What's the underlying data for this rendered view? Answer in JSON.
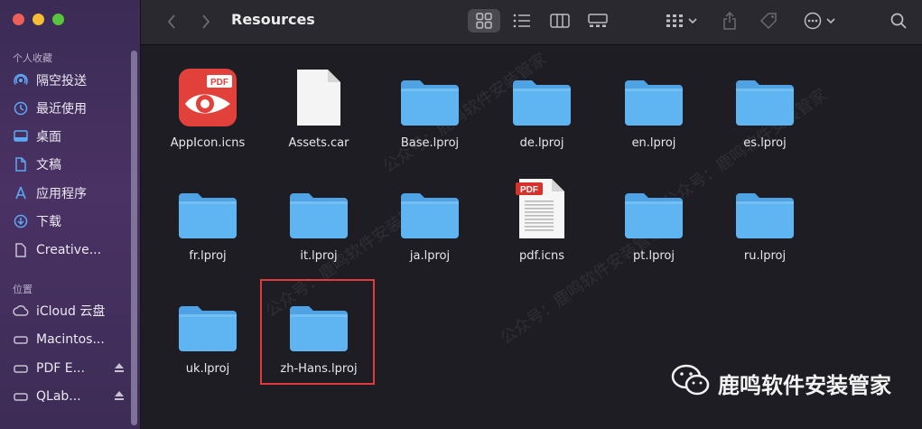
{
  "window": {
    "title": "Resources"
  },
  "sidebar": {
    "favorites_header": "个人收藏",
    "favorites": [
      {
        "label": "隔空投送",
        "icon": "airdrop-icon"
      },
      {
        "label": "最近使用",
        "icon": "clock-icon"
      },
      {
        "label": "桌面",
        "icon": "desktop-icon"
      },
      {
        "label": "文稿",
        "icon": "document-icon"
      },
      {
        "label": "应用程序",
        "icon": "applications-icon"
      },
      {
        "label": "下载",
        "icon": "download-icon"
      },
      {
        "label": "Creative...",
        "icon": "file-icon"
      }
    ],
    "locations_header": "位置",
    "locations": [
      {
        "label": "iCloud 云盘",
        "icon": "cloud-icon"
      },
      {
        "label": "Macintos...",
        "icon": "disk-icon"
      },
      {
        "label": "PDF E...",
        "icon": "disk-icon",
        "eject": true
      },
      {
        "label": "QLab...",
        "icon": "disk-icon",
        "eject": true
      }
    ]
  },
  "files": [
    {
      "name": "AppIcon.icns",
      "kind": "pdfexpert"
    },
    {
      "name": "Assets.car",
      "kind": "blank"
    },
    {
      "name": "Base.lproj",
      "kind": "folder"
    },
    {
      "name": "de.lproj",
      "kind": "folder"
    },
    {
      "name": "en.lproj",
      "kind": "folder"
    },
    {
      "name": "es.lproj",
      "kind": "folder"
    },
    {
      "name": "fr.lproj",
      "kind": "folder"
    },
    {
      "name": "it.lproj",
      "kind": "folder"
    },
    {
      "name": "ja.lproj",
      "kind": "folder"
    },
    {
      "name": "pdf.icns",
      "kind": "pdfdoc"
    },
    {
      "name": "pt.lproj",
      "kind": "folder"
    },
    {
      "name": "ru.lproj",
      "kind": "folder"
    },
    {
      "name": "uk.lproj",
      "kind": "folder"
    },
    {
      "name": "zh-Hans.lproj",
      "kind": "folder"
    }
  ],
  "icon_badges": {
    "pdf": "PDF"
  },
  "watermark": {
    "text": "鹿鸣软件安装管家",
    "diag": "公众号：鹿鸣软件安装管家"
  },
  "colors": {
    "folder": "#5fb4f2",
    "highlight": "#e03a3a",
    "accent": "#5ea8f6"
  }
}
